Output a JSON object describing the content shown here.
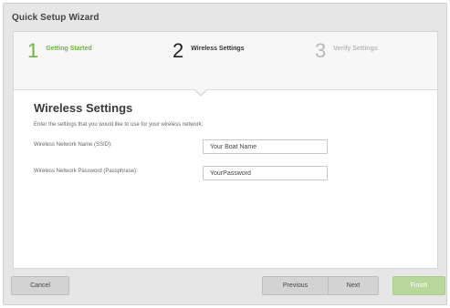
{
  "window": {
    "title": "Quick Setup Wizard"
  },
  "steps": [
    {
      "number": "1",
      "label": "Getting Started"
    },
    {
      "number": "2",
      "label": "Wireless Settings"
    },
    {
      "number": "3",
      "label": "Verify Settings"
    }
  ],
  "main": {
    "title": "Wireless Settings",
    "instructions": "Enter the settings that you would like to use for your wireless network:",
    "ssid_label": "Wireless Network Name (SSID):",
    "ssid_value": "Your Boat Name",
    "password_label": "Wireless Network Password (Passphrase):",
    "password_value": "YourPassword"
  },
  "footer": {
    "cancel_label": "Cancel",
    "previous_label": "Previous",
    "next_label": "Next",
    "finish_label": "Finish"
  },
  "colors": {
    "completed_step": "#6db33f",
    "finish_button": "#b7d89a"
  }
}
